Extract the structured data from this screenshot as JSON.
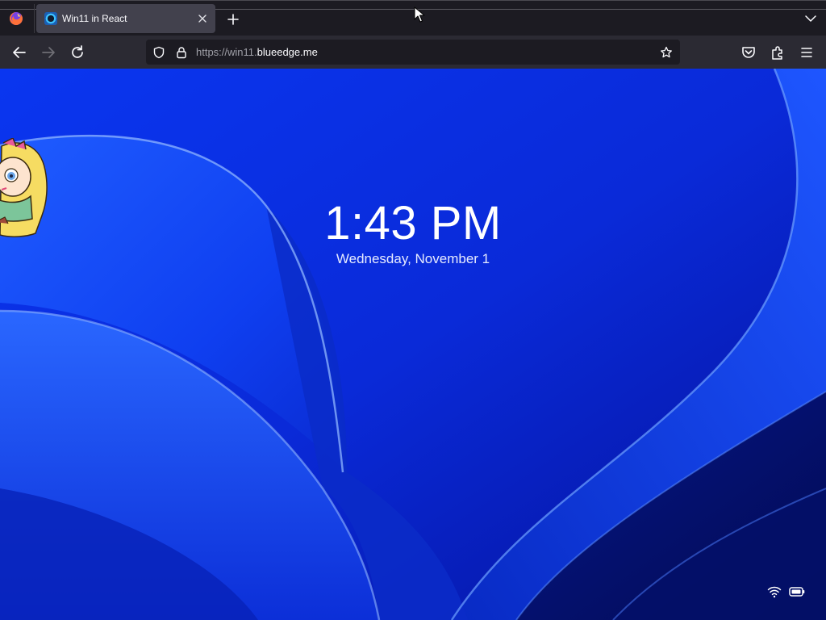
{
  "browser": {
    "tab": {
      "title": "Win11 in React"
    },
    "url": {
      "scheme": "https://win11.",
      "domain": "blueedge.me"
    }
  },
  "lockscreen": {
    "time": "1:43 PM",
    "date": "Wednesday, November 1"
  },
  "icons": {
    "toolbar": [
      "back-arrow-icon",
      "forward-arrow-icon",
      "reload-icon",
      "shield-icon",
      "lock-icon",
      "star-icon",
      "pocket-icon",
      "extensions-icon",
      "hamburger-menu-icon"
    ],
    "tray": [
      "wifi-icon",
      "battery-icon"
    ]
  },
  "colors": {
    "browser_chrome": "#1c1b22",
    "toolbar": "#2b2a33",
    "active_tab": "#42414d",
    "wallpaper_base": "#0a2fe0"
  }
}
